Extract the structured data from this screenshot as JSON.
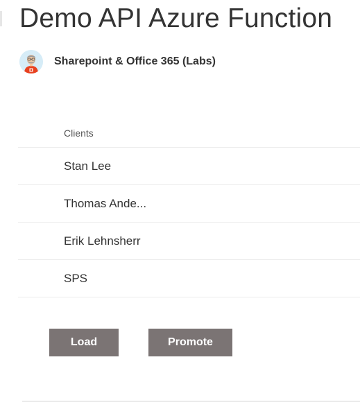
{
  "page": {
    "title": "Demo API Azure Function"
  },
  "site": {
    "name": "Sharepoint & Office 365 (Labs)",
    "avatar_icon": "developer-avatar-office-logo-icon"
  },
  "list": {
    "column_header": "Clients",
    "rows": [
      {
        "client": "Stan Lee"
      },
      {
        "client": "Thomas Ande..."
      },
      {
        "client": "Erik Lehnsherr"
      },
      {
        "client": "SPS"
      }
    ]
  },
  "buttons": {
    "load_label": "Load",
    "promote_label": "Promote"
  },
  "colors": {
    "button_bg": "#7b7474",
    "button_text": "#ffffff",
    "divider": "#ececec"
  }
}
